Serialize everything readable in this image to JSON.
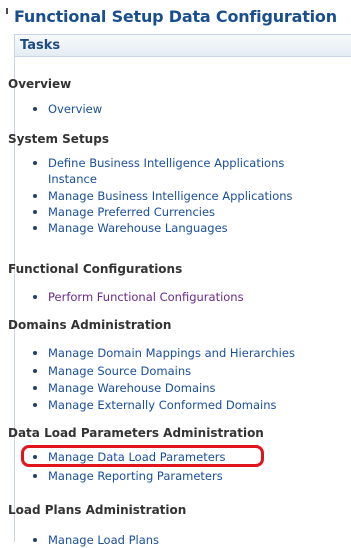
{
  "app": {
    "title": "Functional Setup Data Configuration"
  },
  "panel": {
    "header": "Tasks"
  },
  "sections": [
    {
      "title": "Overview",
      "items": [
        "Overview"
      ]
    },
    {
      "title": "System Setups",
      "items": [
        "Define Business Intelligence Applications Instance",
        "Manage Business Intelligence Applications",
        "Manage Preferred Currencies",
        "Manage Warehouse Languages"
      ]
    },
    {
      "title": "Functional Configurations",
      "items": [
        "Perform Functional Configurations"
      ]
    },
    {
      "title": "Domains Administration",
      "items": [
        "Manage Domain Mappings and Hierarchies",
        "Manage Source Domains",
        "Manage Warehouse Domains",
        "Manage Externally Conformed Domains"
      ]
    },
    {
      "title": "Data Load Parameters Administration",
      "items": [
        "Manage Data Load Parameters",
        "Manage Reporting Parameters"
      ]
    },
    {
      "title": "Load Plans Administration",
      "items": [
        "Manage Load Plans"
      ]
    }
  ],
  "colors": {
    "title": "#1a4f8f",
    "link": "#1a4f9c",
    "visited_link": "#6a2a8a",
    "highlight_border": "#e0141b"
  }
}
